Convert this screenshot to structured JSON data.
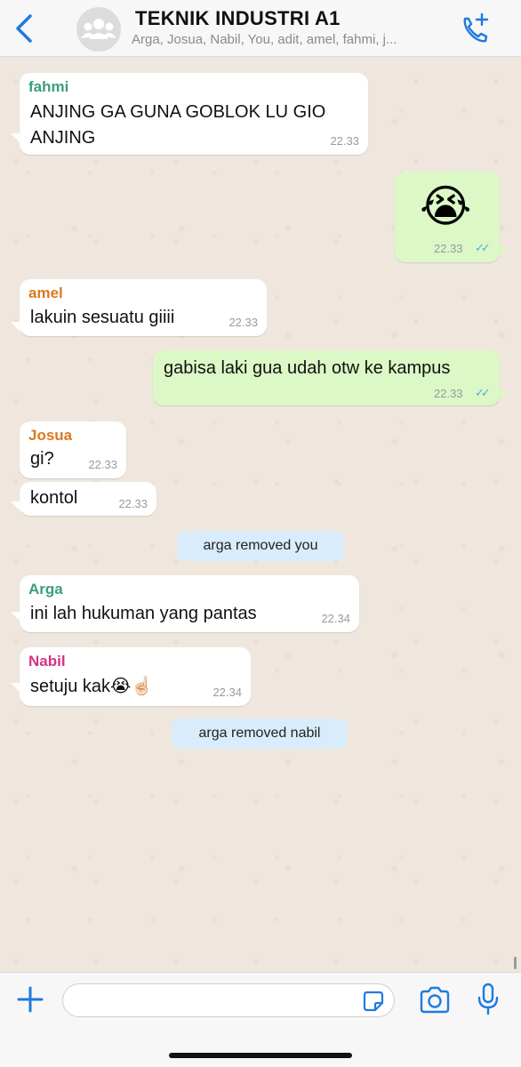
{
  "header": {
    "title": "TEKNIK INDUSTRI A1",
    "members": "Arga, Josua, Nabil, You, adit, amel, fahmi, j..."
  },
  "messages": [
    {
      "sender": "fahmi",
      "sender_color": "#3a9e7b",
      "text_line1": "ANJING GA GUNA GOBLOK LU GIO",
      "text_line2": "ANJING",
      "time": "22.33",
      "direction": "in"
    },
    {
      "emoji": "😭",
      "time": "22.33",
      "ticks": "✓✓",
      "direction": "out"
    },
    {
      "sender": "amel",
      "sender_color": "#d97a1f",
      "text": "lakuin sesuatu giiii",
      "time": "22.33",
      "direction": "in"
    },
    {
      "text": "gabisa laki gua udah otw ke kampus",
      "time": "22.33",
      "ticks": "✓✓",
      "direction": "out"
    },
    {
      "sender": "Josua",
      "sender_color": "#d97a1f",
      "text": "gi?",
      "time": "22.33",
      "direction": "in"
    },
    {
      "text": "kontol",
      "time": "22.33",
      "direction": "in"
    },
    {
      "system": "arga removed you"
    },
    {
      "sender": "Arga",
      "sender_color": "#3a9e7b",
      "text": "ini lah hukuman yang pantas",
      "time": "22.34",
      "direction": "in"
    },
    {
      "sender": "Nabil",
      "sender_color": "#d63384",
      "text": "setuju kak😭☝🏻",
      "time": "22.34",
      "direction": "in"
    },
    {
      "system": "arga removed nabil"
    }
  ],
  "composer": {
    "value": ""
  },
  "colors": {
    "accent": "#1f7ae0",
    "tick_read": "#4fa8e8",
    "outgoing_bubble": "#dcf8c6",
    "system_bubble": "#d9ecfb"
  },
  "icons": {
    "back": "chevron-left-icon",
    "avatar": "group-avatar-icon",
    "call": "add-call-icon",
    "plus": "plus-icon",
    "sticker": "sticker-icon",
    "camera": "camera-icon",
    "mic": "microphone-icon"
  }
}
